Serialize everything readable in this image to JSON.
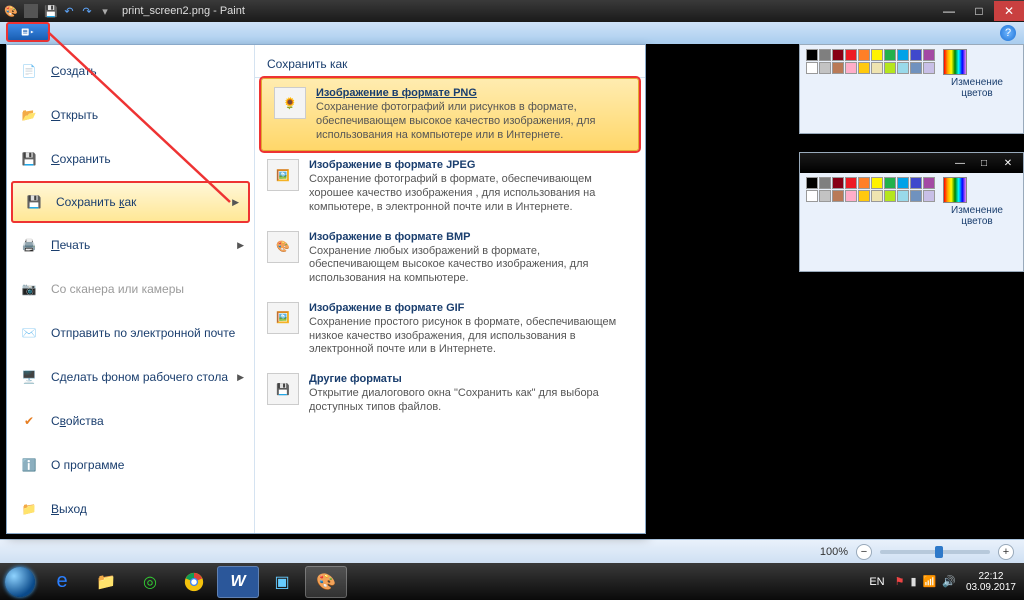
{
  "titlebar": {
    "filename": "print_screen2.png - Paint",
    "min": "—",
    "max": "□",
    "close": "✕"
  },
  "appmenu": {
    "items": [
      {
        "label": "Создать",
        "underline": "С",
        "rest": "оздать"
      },
      {
        "label": "Открыть",
        "underline": "О",
        "rest": "ткрыть"
      },
      {
        "label": "Сохранить",
        "underline": "С",
        "rest": "охранить"
      },
      {
        "label": "Сохранить как",
        "underline": "к",
        "pre": "Сохранить ",
        "rest": "ак"
      },
      {
        "label": "Печать",
        "underline": "П",
        "rest": "ечать"
      },
      {
        "label": "Со сканера или камеры"
      },
      {
        "label": "Отправить по электронной почте"
      },
      {
        "label": "Сделать фоном рабочего стола"
      },
      {
        "label": "Свойства",
        "underline": "в",
        "pre": "С",
        "rest": "ойства"
      },
      {
        "label": "О программе"
      },
      {
        "label": "Выход",
        "underline": "В",
        "rest": "ыход"
      }
    ],
    "right_header": "Сохранить как",
    "formats": [
      {
        "title": "Изображение в формате PNG",
        "desc": "Сохранение фотографий или рисунков в формате, обеспечивающем высокое качество изображения, для использования на компьютере или в Интернете."
      },
      {
        "title": "Изображение в формате JPEG",
        "desc": "Сохранение фотографий в формате, обеспечивающем хорошее качество изображения , для использования на компьютере, в электронной почте или в Интернете."
      },
      {
        "title": "Изображение в формате BMP",
        "desc": "Сохранение любых изображений в формате, обеспечивающем высокое качество изображения, для использования на компьютере."
      },
      {
        "title": "Изображение в формате GIF",
        "desc": "Сохранение простого рисунок в формате, обеспечивающем низкое качество изображения, для использования в электронной почте или в Интернете."
      },
      {
        "title": "Другие форматы",
        "desc": "Открытие диалогового окна \"Сохранить как\" для выбора доступных типов файлов."
      }
    ]
  },
  "palette_label": "Изменение цветов",
  "palette_colors_row1": [
    "#000",
    "#7f7f7f",
    "#880015",
    "#ed1c24",
    "#ff7f27",
    "#fff200",
    "#22b14c",
    "#00a2e8",
    "#3f48cc",
    "#a349a4"
  ],
  "palette_colors_row2": [
    "#fff",
    "#c3c3c3",
    "#b97a57",
    "#ffaec9",
    "#ffc90e",
    "#efe4b0",
    "#b5e61d",
    "#99d9ea",
    "#7092be",
    "#c8bfe7"
  ],
  "status": {
    "zoom": "100%"
  },
  "tray": {
    "lang": "EN",
    "time": "22:12",
    "date": "03.09.2017"
  }
}
